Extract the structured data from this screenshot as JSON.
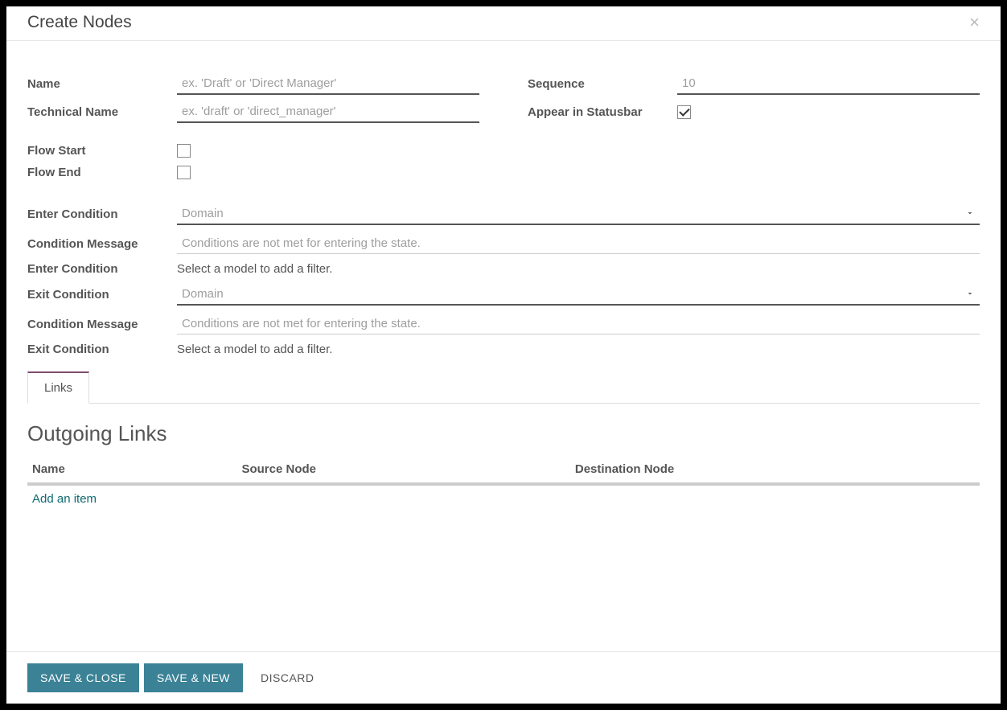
{
  "modal": {
    "title": "Create Nodes",
    "close": "×"
  },
  "fields": {
    "name_label": "Name",
    "name_placeholder": "ex. 'Draft' or 'Direct Manager'",
    "tech_name_label": "Technical Name",
    "tech_name_placeholder": "ex. 'draft' or 'direct_manager'",
    "sequence_label": "Sequence",
    "sequence_placeholder": "10",
    "appear_statusbar_label": "Appear in Statusbar",
    "appear_statusbar_checked": true,
    "flow_start_label": "Flow Start",
    "flow_start_checked": false,
    "flow_end_label": "Flow End",
    "flow_end_checked": false,
    "enter_condition_label": "Enter Condition",
    "enter_condition_value": "Domain",
    "condition_message_label": "Condition Message",
    "condition_message_placeholder": "Conditions are not met for entering the state.",
    "enter_condition2_label": "Enter Condition",
    "enter_condition2_text": "Select a model to add a filter.",
    "exit_condition_label": "Exit Condition",
    "exit_condition_value": "Domain",
    "condition_message2_label": "Condition Message",
    "condition_message2_placeholder": "Conditions are not met for entering the state.",
    "exit_condition2_label": "Exit Condition",
    "exit_condition2_text": "Select a model to add a filter."
  },
  "tabs": {
    "links": "Links"
  },
  "outgoing": {
    "title": "Outgoing Links",
    "col_name": "Name",
    "col_source": "Source Node",
    "col_dest": "Destination Node",
    "add_item": "Add an item"
  },
  "footer": {
    "save_close": "SAVE & CLOSE",
    "save_new": "SAVE & NEW",
    "discard": "DISCARD"
  }
}
